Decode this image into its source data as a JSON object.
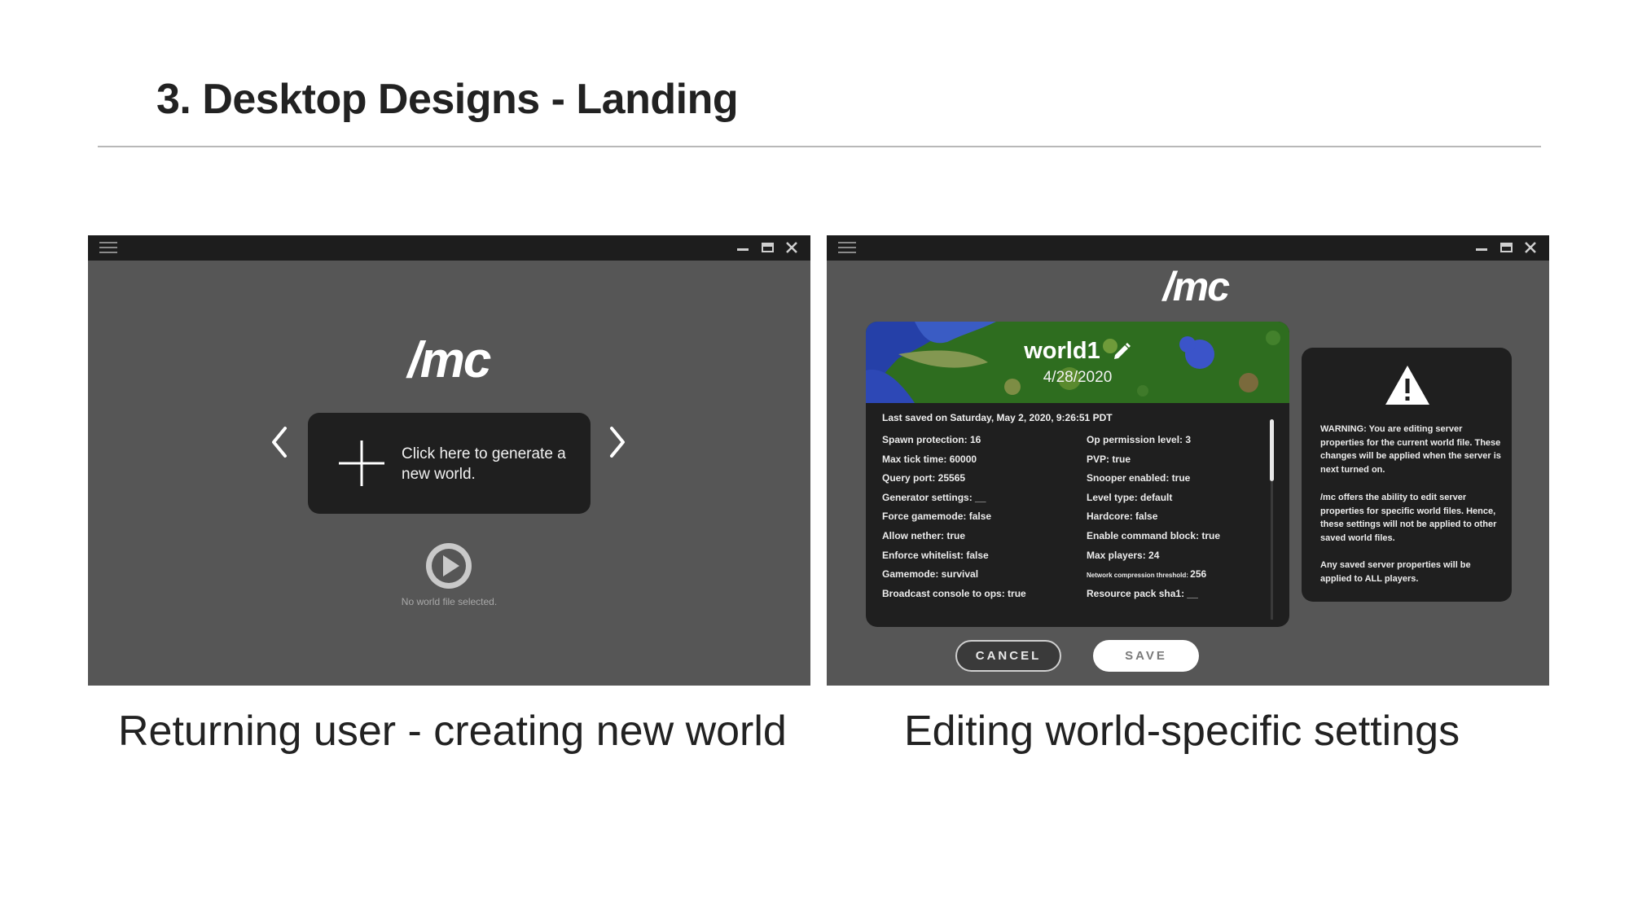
{
  "slide": {
    "title": "3. Desktop Designs - Landing",
    "captions": [
      "Returning user - creating new world",
      "Editing world-specific settings"
    ]
  },
  "colors": {
    "window_bg": "#565656",
    "titlebar_bg": "#1d1d1d",
    "card_bg": "#1f1f1f",
    "text_light": "#f2f2f2"
  },
  "left_window": {
    "logo": "/mc",
    "generate_card": {
      "icon": "plus-icon",
      "text": "Click here to generate a new world."
    },
    "nav": {
      "prev_icon": "chevron-left-icon",
      "next_icon": "chevron-right-icon"
    },
    "play_icon": "play-icon",
    "status": "No world file selected."
  },
  "right_window": {
    "logo": "/mc",
    "world": {
      "name": "world1",
      "date": "4/28/2020",
      "edit_icon": "pencil-icon",
      "last_saved": "Last saved on Saturday, May 2, 2020, 9:26:51 PDT"
    },
    "properties_left": [
      "Spawn protection: 16",
      "Max tick time: 60000",
      "Query port: 25565",
      "Generator settings: __",
      "Force gamemode: false",
      "Allow nether: true",
      "Enforce whitelist: false",
      "Gamemode: survival",
      "Broadcast console to ops: true"
    ],
    "properties_right": [
      "Op permission level: 3",
      "PVP: true",
      "Snooper enabled: true",
      "Level type: default",
      "Hardcore: false",
      "Enable command block: true",
      "Max players: 24",
      {
        "label": "Network compression threshold:",
        "value": "256"
      },
      "Resource pack sha1: __"
    ],
    "warning": {
      "icon": "warning-icon",
      "paragraphs": [
        "WARNING: You are editing server properties for the current world file. These changes will be applied when the server is next turned on.",
        "/mc offers the ability to edit server properties for specific world files. Hence, these settings will not be applied to other saved world files.",
        "Any saved server properties will be applied to ALL players."
      ]
    },
    "buttons": {
      "cancel": "CANCEL",
      "save": "SAVE"
    }
  }
}
